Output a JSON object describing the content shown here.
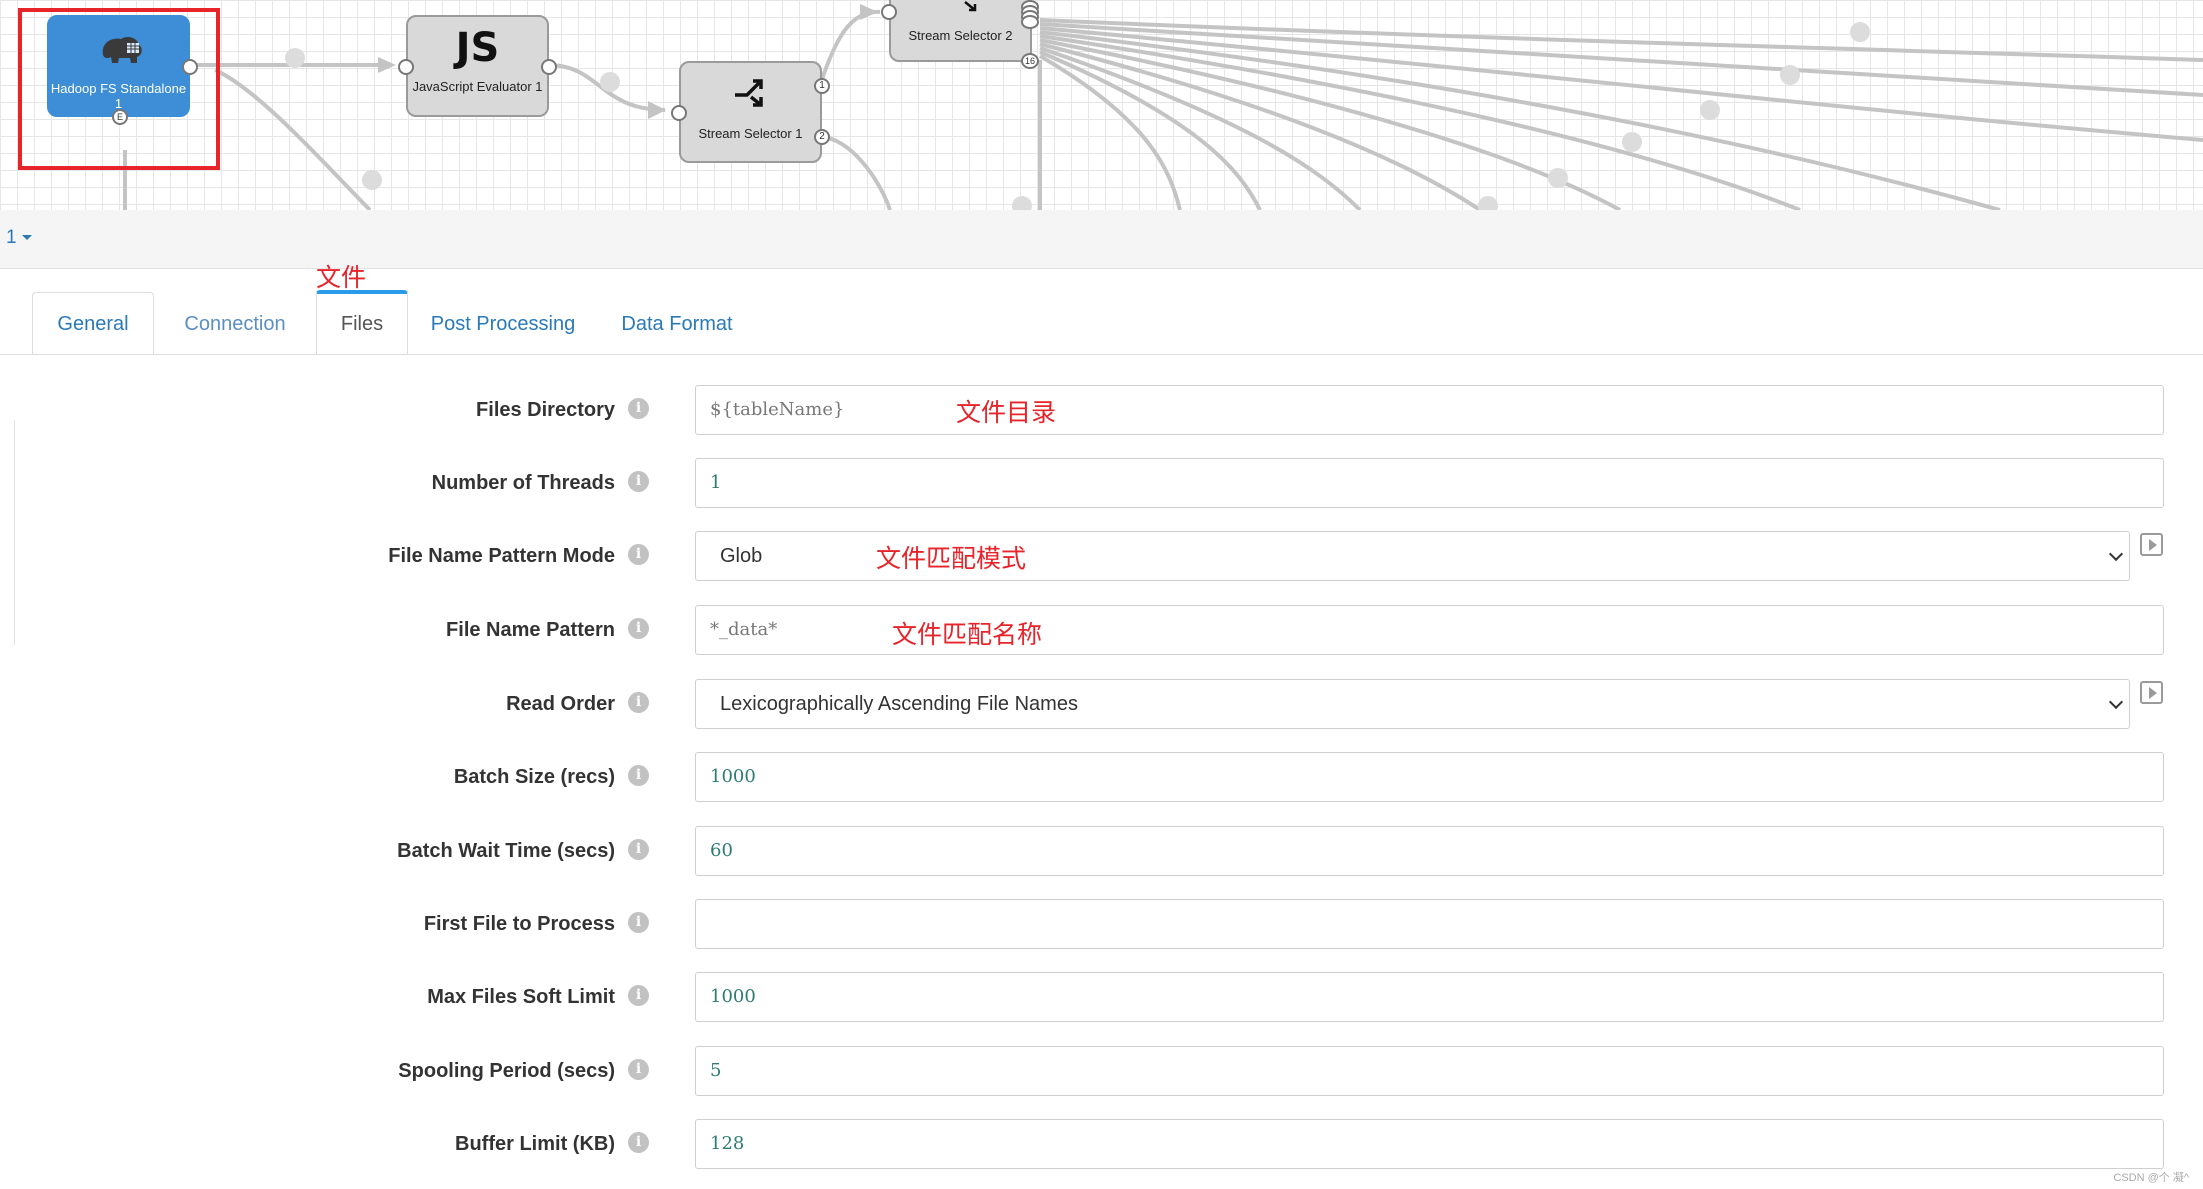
{
  "canvas": {
    "nodes": [
      {
        "id": "hadoop",
        "label": "Hadoop FS Standalone 1",
        "icon": "hadoop-elephant-icon",
        "error_port": "E"
      },
      {
        "id": "js",
        "icon_text": "JS",
        "label": "JavaScript Evaluator 1"
      },
      {
        "id": "sel1",
        "label": "Stream Selector 1",
        "ports": [
          "1",
          "2"
        ]
      },
      {
        "id": "sel2",
        "label": "Stream Selector 2",
        "last_port": "16"
      }
    ]
  },
  "stage_selector": {
    "value": "1"
  },
  "annotations": {
    "files_tab": "文件",
    "files_directory": "文件目录",
    "pattern_mode": "文件匹配模式",
    "pattern_name": "文件匹配名称"
  },
  "tabs": [
    {
      "label": "General"
    },
    {
      "label": "Connection"
    },
    {
      "label": "Files",
      "active": true
    },
    {
      "label": "Post Processing"
    },
    {
      "label": "Data Format"
    }
  ],
  "form": {
    "files_directory": {
      "label": "Files Directory",
      "placeholder": "${tableName}"
    },
    "number_of_threads": {
      "label": "Number of Threads",
      "value": "1"
    },
    "file_name_pattern_mode": {
      "label": "File Name Pattern Mode",
      "value": "Glob"
    },
    "file_name_pattern": {
      "label": "File Name Pattern",
      "placeholder": "*_data*"
    },
    "read_order": {
      "label": "Read Order",
      "value": "Lexicographically Ascending File Names"
    },
    "batch_size": {
      "label": "Batch Size (recs)",
      "value": "1000"
    },
    "batch_wait_time": {
      "label": "Batch Wait Time (secs)",
      "value": "60"
    },
    "first_file": {
      "label": "First File to Process",
      "value": ""
    },
    "max_files_soft_limit": {
      "label": "Max Files Soft Limit",
      "value": "1000"
    },
    "spooling_period": {
      "label": "Spooling Period (secs)",
      "value": "5"
    },
    "buffer_limit": {
      "label": "Buffer Limit (KB)",
      "value": "128"
    }
  },
  "info_icon_glyph": "i",
  "watermark": "CSDN @个 凝^"
}
